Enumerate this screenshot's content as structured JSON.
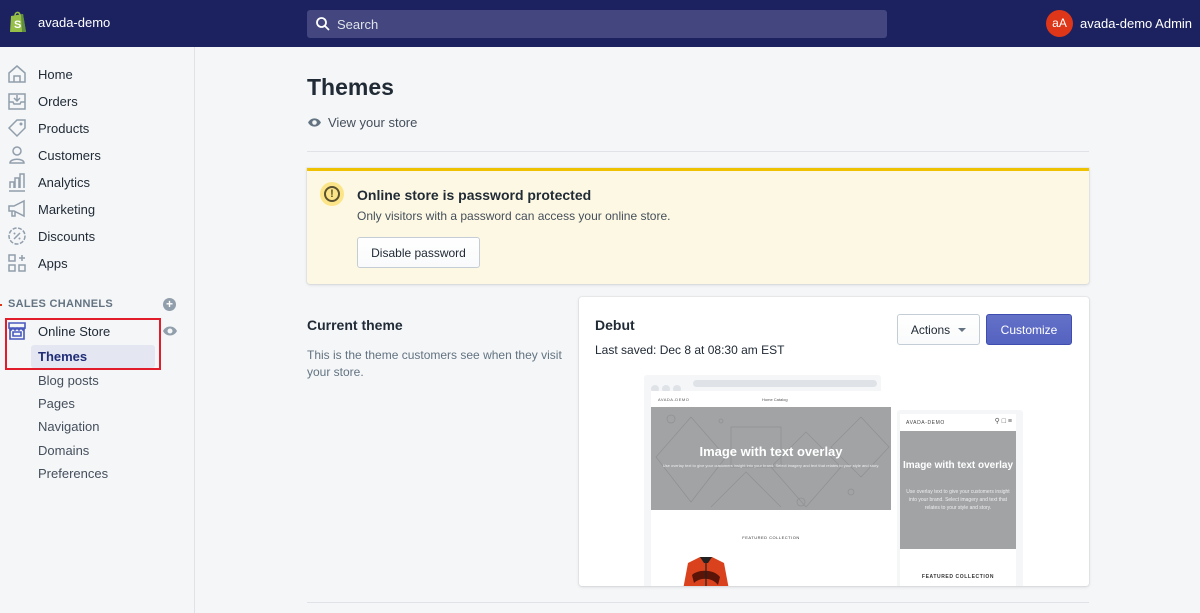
{
  "topbar": {
    "store_name": "avada-demo",
    "search_placeholder": "Search",
    "avatar_initials": "aA",
    "user_name": "avada-demo Admin",
    "brand_color": "#1c2260"
  },
  "sidebar": {
    "items": [
      {
        "label": "Home",
        "icon": "home-icon"
      },
      {
        "label": "Orders",
        "icon": "orders-icon"
      },
      {
        "label": "Products",
        "icon": "tag-icon"
      },
      {
        "label": "Customers",
        "icon": "person-icon"
      },
      {
        "label": "Analytics",
        "icon": "bar-chart-icon"
      },
      {
        "label": "Marketing",
        "icon": "megaphone-icon"
      },
      {
        "label": "Discounts",
        "icon": "discount-icon"
      },
      {
        "label": "Apps",
        "icon": "apps-icon"
      }
    ],
    "sales_channels_title": "SALES CHANNELS",
    "channel": {
      "label": "Online Store",
      "icon": "store-icon"
    },
    "sub_items": [
      {
        "label": "Themes",
        "active": true
      },
      {
        "label": "Blog posts"
      },
      {
        "label": "Pages"
      },
      {
        "label": "Navigation"
      },
      {
        "label": "Domains"
      },
      {
        "label": "Preferences"
      }
    ],
    "highlight_color": "#e11d2b"
  },
  "main": {
    "title": "Themes",
    "view_store": "View your store",
    "banner": {
      "title": "Online store is password protected",
      "text": "Only visitors with a password can access your online store.",
      "button": "Disable password"
    },
    "current_theme": {
      "title": "Current theme",
      "description": "This is the theme customers see when they visit your store."
    },
    "theme_card": {
      "name": "Debut",
      "last_saved": "Last saved: Dec 8 at 08:30 am EST",
      "actions_label": "Actions",
      "customize_label": "Customize",
      "accent_color": "#5c6ac4"
    },
    "preview": {
      "desktop_brand": "AVADA-DEMO",
      "desktop_links": "Home   Catalog",
      "hero_title": "Image with text overlay",
      "hero_text": "Use overlay text to give your customers insight into your brand. Select imagery and text that relates to your style and story.",
      "featured": "FEATURED COLLECTION",
      "mobile_brand": "AVADA-DEMO",
      "mobile_hero_title": "Image with text overlay",
      "mobile_hero_text": "Use overlay text to give your customers insight into your brand. Select imagery and text that relates to your style and story.",
      "mobile_featured": "FEATURED COLLECTION"
    }
  }
}
